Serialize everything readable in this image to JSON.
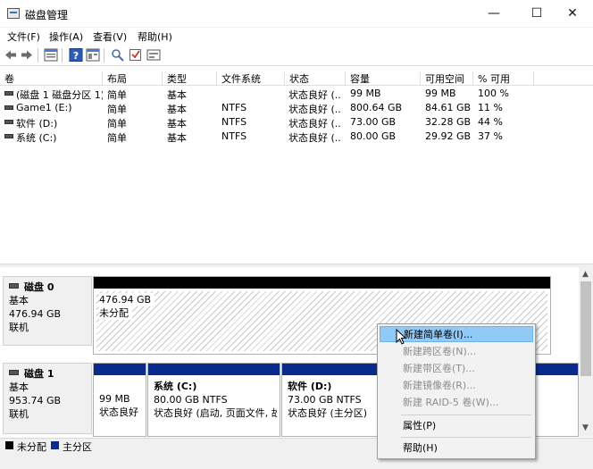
{
  "window": {
    "title": "磁盘管理",
    "min": "—",
    "max": "☐",
    "close": "✕"
  },
  "menu": [
    "文件(F)",
    "操作(A)",
    "查看(V)",
    "帮助(H)"
  ],
  "toolbar_icons": [
    "back-arrow-icon",
    "forward-arrow-icon",
    "disk-list-icon",
    "help-icon",
    "properties-icon",
    "rescan-icon",
    "check-icon",
    "volume-icon"
  ],
  "volume_table": {
    "headers": [
      "卷",
      "布局",
      "类型",
      "文件系统",
      "状态",
      "容量",
      "可用空间",
      "% 可用"
    ],
    "rows": [
      [
        "(磁盘 1 磁盘分区 1)",
        "简单",
        "基本",
        "",
        "状态良好 (...",
        "99 MB",
        "99 MB",
        "100 %"
      ],
      [
        "Game1 (E:)",
        "简单",
        "基本",
        "NTFS",
        "状态良好 (...",
        "800.64 GB",
        "84.61 GB",
        "11 %"
      ],
      [
        "软件 (D:)",
        "简单",
        "基本",
        "NTFS",
        "状态良好 (...",
        "73.00 GB",
        "32.28 GB",
        "44 %"
      ],
      [
        "系统 (C:)",
        "简单",
        "基本",
        "NTFS",
        "状态良好 (...",
        "80.00 GB",
        "29.92 GB",
        "37 %"
      ]
    ]
  },
  "disks": [
    {
      "name": "磁盘 0",
      "type": "基本",
      "size": "476.94 GB",
      "status": "联机"
    },
    {
      "name": "磁盘 1",
      "type": "基本",
      "size": "953.74 GB",
      "status": "联机"
    }
  ],
  "disk0_partition": {
    "size": "476.94 GB",
    "label": "未分配"
  },
  "disk1_partitions": [
    {
      "name": "",
      "size": "99 MB",
      "status": "状态良好"
    },
    {
      "name": "系统  (C:)",
      "size": "80.00 GB NTFS",
      "status": "状态良好 (启动, 页面文件, 故"
    },
    {
      "name": "软件  (D:)",
      "size": "73.00 GB NTFS",
      "status": "状态良好 (主分区)"
    }
  ],
  "legend": [
    {
      "label": "未分配",
      "color": "#000000"
    },
    {
      "label": "主分区",
      "color": "#0a2a8c"
    }
  ],
  "context_menu": {
    "items": [
      {
        "label": "新建简单卷(I)...",
        "state": "highlighted"
      },
      {
        "label": "新建跨区卷(N)...",
        "state": "disabled"
      },
      {
        "label": "新建带区卷(T)...",
        "state": "disabled"
      },
      {
        "label": "新建镜像卷(R)...",
        "state": "disabled"
      },
      {
        "label": "新建 RAID-5 卷(W)...",
        "state": "disabled"
      },
      {
        "label": "属性(P)",
        "state": "normal"
      },
      {
        "label": "帮助(H)",
        "state": "normal"
      }
    ]
  },
  "colors": {
    "primary_partition": "#0a2a8c",
    "unallocated": "#000000",
    "highlight": "#91c9f7"
  }
}
